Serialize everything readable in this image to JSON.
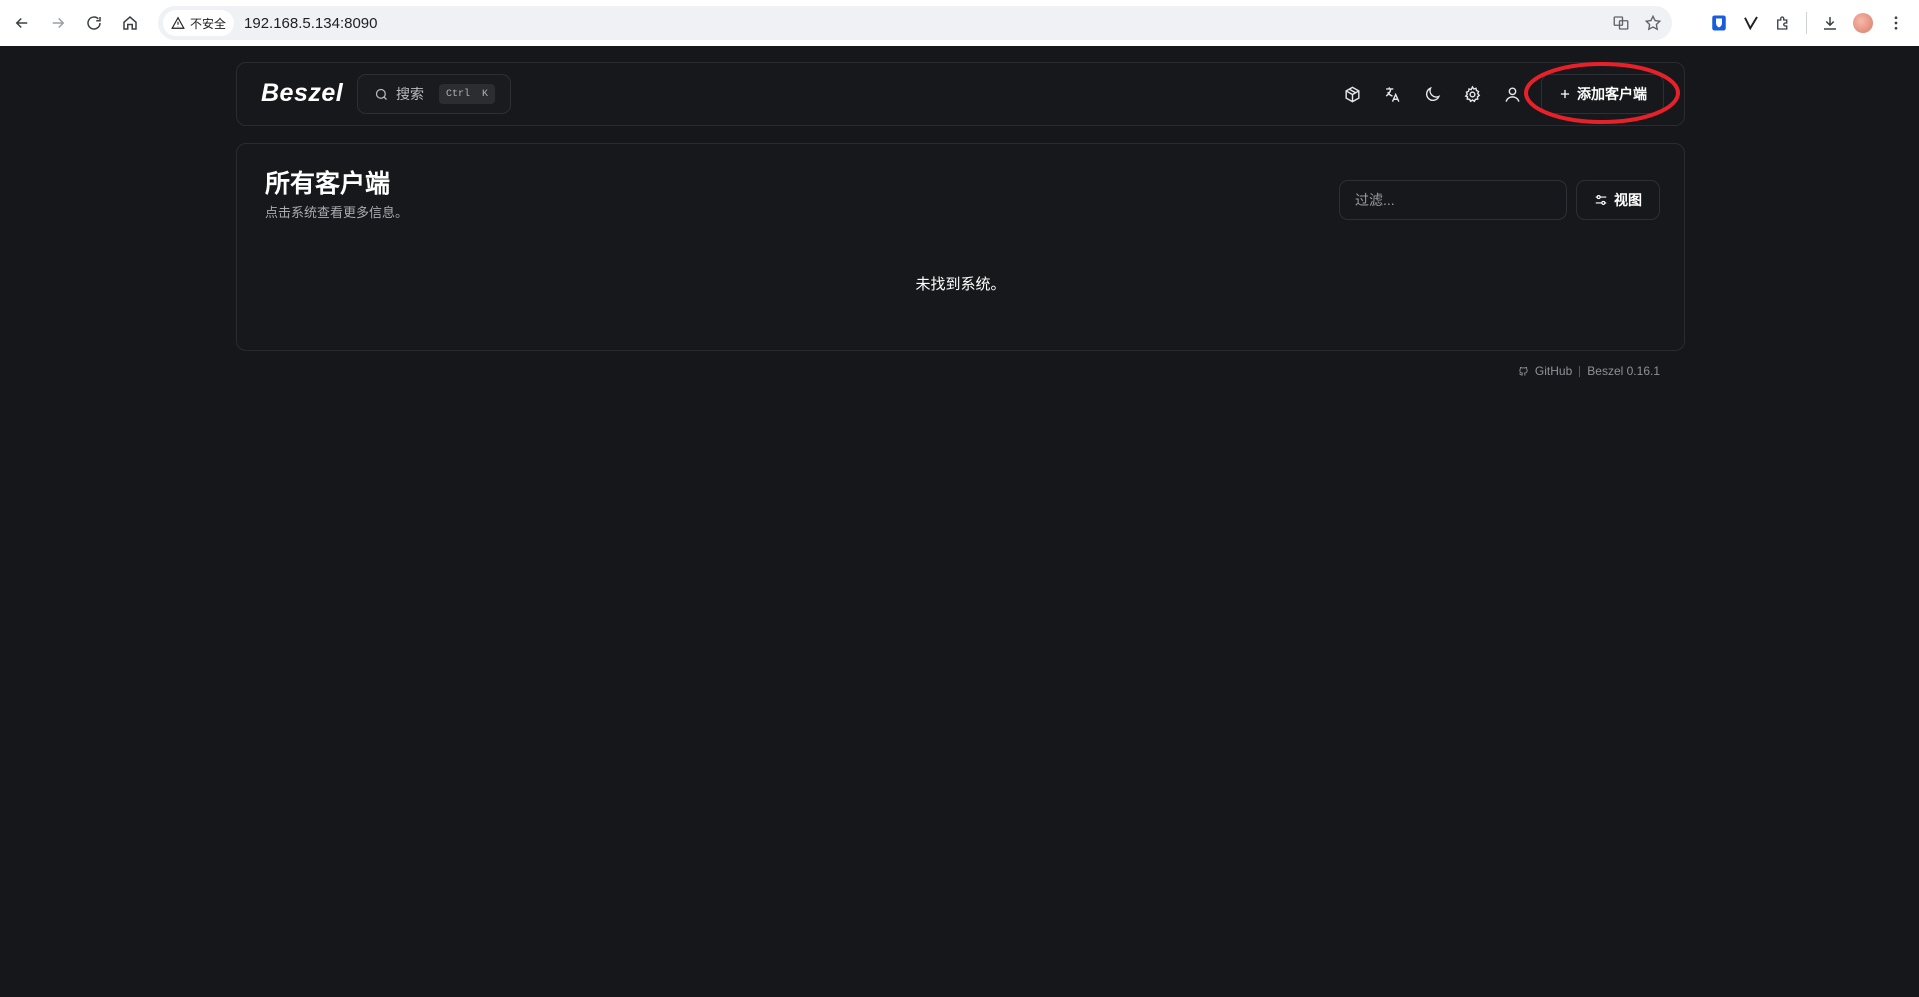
{
  "browser": {
    "security_label": "不安全",
    "url": "192.168.5.134:8090"
  },
  "app": {
    "logo": "Beszel",
    "search": {
      "label": "搜索",
      "shortcut_ctrl": "Ctrl",
      "shortcut_key": "K"
    },
    "add_button_label": "添加客户端"
  },
  "main": {
    "title": "所有客户端",
    "subtitle": "点击系统查看更多信息。",
    "filter_placeholder": "过滤...",
    "view_button_label": "视图",
    "empty_message": "未找到系统。"
  },
  "footer": {
    "github_label": "GitHub",
    "version_label": "Beszel 0.16.1"
  },
  "annotation": {
    "highlight_color": "#e8202a"
  }
}
